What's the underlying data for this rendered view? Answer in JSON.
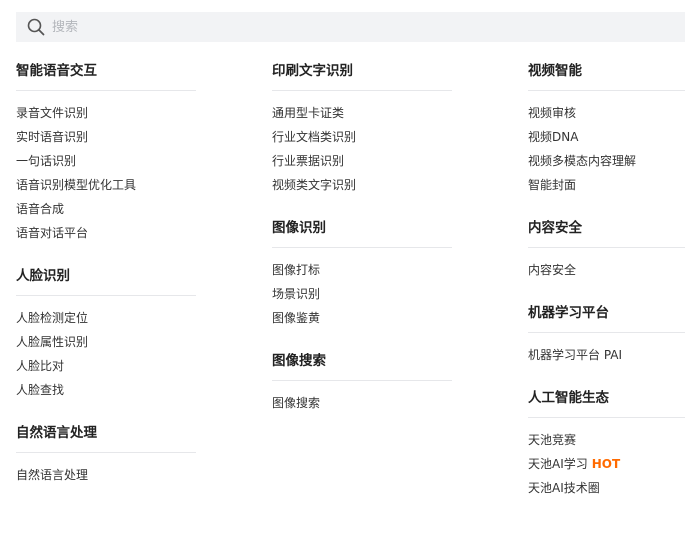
{
  "search": {
    "placeholder": "搜索"
  },
  "columns": [
    {
      "sections": [
        {
          "title": "智能语音交互",
          "items": [
            "录音文件识别",
            "实时语音识别",
            "一句话识别",
            "语音识别模型优化工具",
            "语音合成",
            "语音对话平台"
          ]
        },
        {
          "title": "人脸识别",
          "items": [
            "人脸检测定位",
            "人脸属性识别",
            "人脸比对",
            "人脸查找"
          ]
        },
        {
          "title": "自然语言处理",
          "items": [
            "自然语言处理"
          ]
        }
      ]
    },
    {
      "sections": [
        {
          "title": "印刷文字识别",
          "items": [
            "通用型卡证类",
            "行业文档类识别",
            "行业票据识别",
            "视频类文字识别"
          ]
        },
        {
          "title": "图像识别",
          "items": [
            "图像打标",
            "场景识别",
            "图像鉴黄"
          ]
        },
        {
          "title": "图像搜索",
          "items": [
            "图像搜索"
          ]
        }
      ]
    },
    {
      "sections": [
        {
          "title": "视频智能",
          "items": [
            "视频审核",
            "视频DNA",
            "视频多模态内容理解",
            "智能封面"
          ]
        },
        {
          "title": "内容安全",
          "items": [
            "内容安全"
          ]
        },
        {
          "title": "机器学习平台",
          "items": [
            "机器学习平台 PAI"
          ]
        },
        {
          "title": "人工智能生态",
          "items": [
            "天池竞赛",
            "天池AI学习",
            "天池AI技术圈"
          ]
        }
      ]
    }
  ],
  "badges": {
    "hot": "HOT"
  },
  "colors": {
    "hot": "#ff6a00",
    "search_bg": "#f2f3f5",
    "divider": "#e6e7ea"
  }
}
